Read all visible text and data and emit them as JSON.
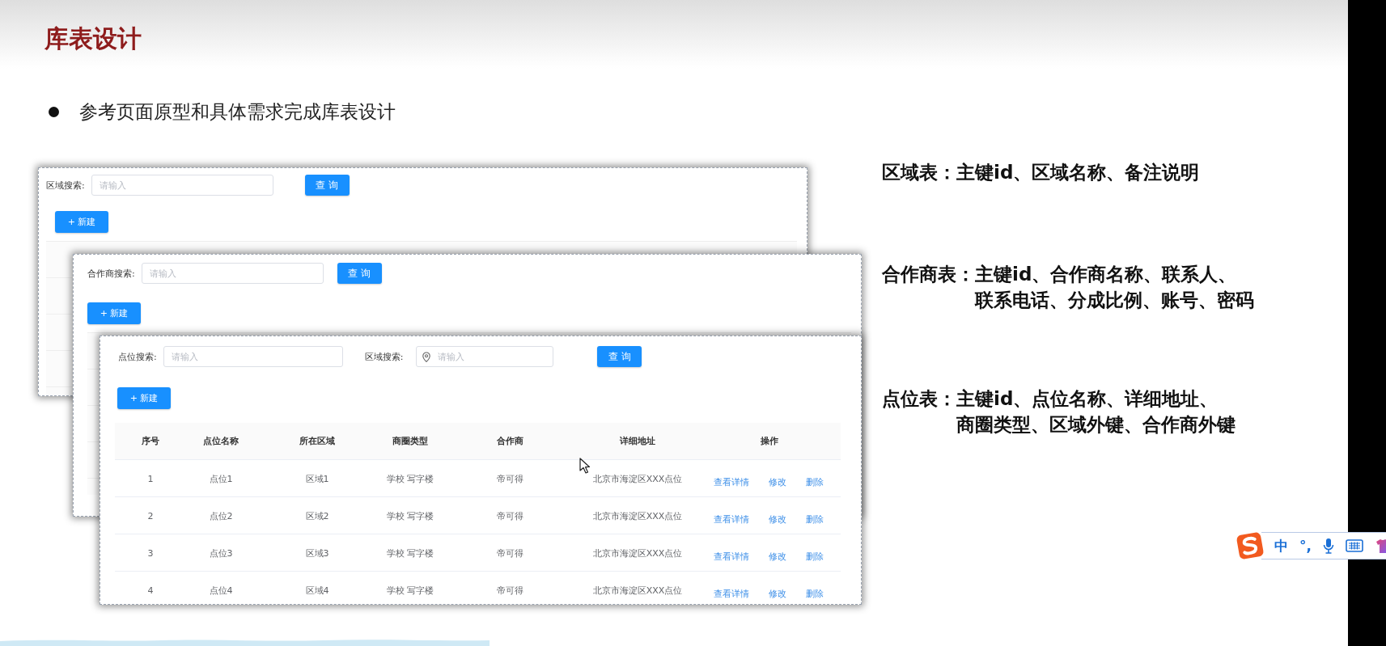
{
  "slide": {
    "title": "库表设计",
    "bullets": [
      "参考页面原型和具体需求完成库表设计"
    ]
  },
  "mockups": [
    {
      "search_fields": [
        {
          "label": "区域搜索:",
          "placeholder": "请输入",
          "kind": "plain"
        }
      ],
      "query_button": "查 询",
      "new_button": "+ 新建"
    },
    {
      "search_fields": [
        {
          "label": "合作商搜索:",
          "placeholder": "请输入",
          "kind": "plain"
        }
      ],
      "query_button": "查 询",
      "new_button": "+ 新建"
    },
    {
      "search_fields": [
        {
          "label": "点位搜索:",
          "placeholder": "请输入",
          "kind": "plain"
        },
        {
          "label": "区域搜索:",
          "placeholder": "请输入",
          "kind": "location"
        }
      ],
      "query_button": "查 询",
      "new_button": "+ 新建",
      "table": {
        "columns": [
          "序号",
          "点位名称",
          "所在区域",
          "商圈类型",
          "合作商",
          "详细地址",
          "操作"
        ],
        "rows": [
          {
            "cells": [
              "1",
              "点位1",
              "区域1",
              "学校 写字楼",
              "帝可得",
              "北京市海淀区XXX点位"
            ],
            "actions": [
              "查看详情",
              "修改",
              "删除"
            ]
          },
          {
            "cells": [
              "2",
              "点位2",
              "区域2",
              "学校 写字楼",
              "帝可得",
              "北京市海淀区XXX点位"
            ],
            "actions": [
              "查看详情",
              "修改",
              "删除"
            ]
          },
          {
            "cells": [
              "3",
              "点位3",
              "区域3",
              "学校 写字楼",
              "帝可得",
              "北京市海淀区XXX点位"
            ],
            "actions": [
              "查看详情",
              "修改",
              "删除"
            ]
          },
          {
            "cells": [
              "4",
              "点位4",
              "区域4",
              "学校 写字楼",
              "帝可得",
              "北京市海淀区XXX点位"
            ],
            "actions": [
              "查看详情",
              "修改",
              "删除"
            ]
          }
        ]
      }
    }
  ],
  "notes": [
    {
      "label": "区域表：",
      "lines": [
        "主键id、区域名称、备注说明"
      ]
    },
    {
      "label": "合作商表：",
      "lines": [
        "主键id、合作商名称、联系人、",
        "联系电话、分成比例、账号、密码"
      ]
    },
    {
      "label": "点位表：",
      "lines": [
        "主键id、点位名称、详细地址、",
        "商圈类型、区域外键、合作商外键"
      ]
    }
  ],
  "ime_toolbar": {
    "items": [
      "中",
      "°,"
    ]
  }
}
